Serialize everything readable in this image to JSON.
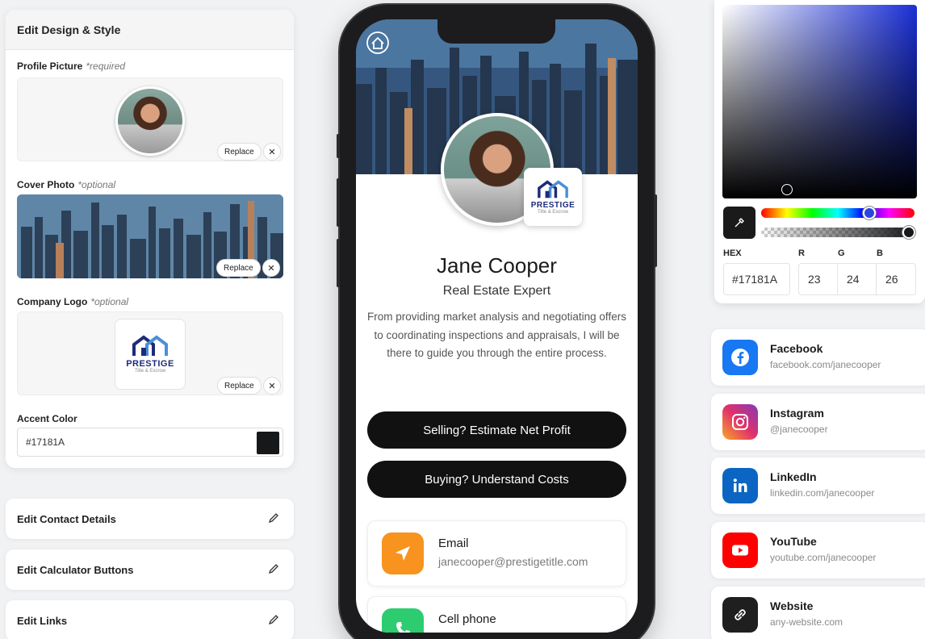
{
  "editor": {
    "header": "Edit Design & Style",
    "profile_label": "Profile Picture",
    "profile_hint": "*required",
    "cover_label": "Cover Photo",
    "cover_hint": "*optional",
    "logo_label": "Company Logo",
    "logo_hint": "*optional",
    "replace_label": "Replace",
    "remove_symbol": "✕",
    "accent_label": "Accent Color",
    "accent_value": "#17181A",
    "logo_word": "PRESTIGE",
    "logo_sub": "Title & Escrow"
  },
  "sections": {
    "contact": "Edit Contact Details",
    "calculator": "Edit Calculator Buttons",
    "links": "Edit Links"
  },
  "profile": {
    "name": "Jane Cooper",
    "title": "Real Estate Expert",
    "bio": "From providing market analysis and negotiating offers to coordinating inspections and appraisals, I will be there to guide you through the entire process.",
    "cta_sell": "Selling? Estimate Net Profit",
    "cta_buy": "Buying? Understand Costs",
    "contacts": [
      {
        "title": "Email",
        "value": "janecooper@prestigetitle.com",
        "icon": "send-icon",
        "color": "#F7931E"
      },
      {
        "title": "Cell phone",
        "value": "",
        "icon": "phone-icon",
        "color": "#2ECC71"
      }
    ]
  },
  "picker": {
    "hex_label": "HEX",
    "r_label": "R",
    "g_label": "G",
    "b_label": "B",
    "hex": "#17181A",
    "r": "23",
    "g": "24",
    "b": "26"
  },
  "social": [
    {
      "name": "Facebook",
      "handle": "facebook.com/janecooper",
      "icon": "facebook-icon",
      "color": "#1877F2"
    },
    {
      "name": "Instagram",
      "handle": "@janecooper",
      "icon": "instagram-icon",
      "color": "#C13584"
    },
    {
      "name": "LinkedIn",
      "handle": "linkedin.com/janecooper",
      "icon": "linkedin-icon",
      "color": "#0A66C2"
    },
    {
      "name": "YouTube",
      "handle": "youtube.com/janecooper",
      "icon": "youtube-icon",
      "color": "#FF0000"
    },
    {
      "name": "Website",
      "handle": "any-website.com",
      "icon": "link-icon",
      "color": "#1F1F1F"
    }
  ],
  "colors": {
    "accent": "#17181A",
    "logo_blue": "#1E2B7A"
  }
}
